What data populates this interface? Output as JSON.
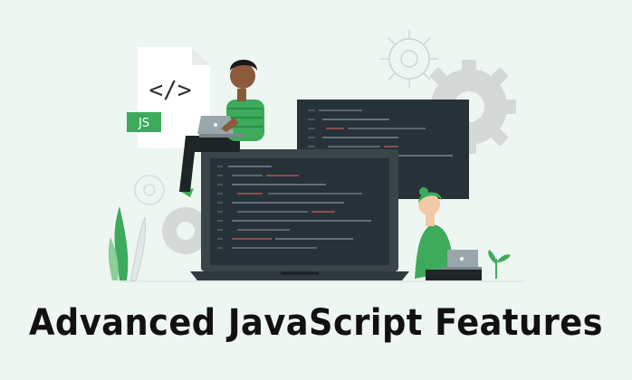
{
  "title": "Advanced JavaScript Features",
  "file_badge_label": "JS",
  "code_symbol": "</>",
  "colors": {
    "background": "#eef6f2",
    "accent_green": "#3daa5c",
    "screen_dark": "#263238",
    "title_text": "#111111"
  },
  "icons": [
    "code-file-icon",
    "gear-icon",
    "laptop-icon",
    "plant-icon",
    "monitor-icon"
  ]
}
